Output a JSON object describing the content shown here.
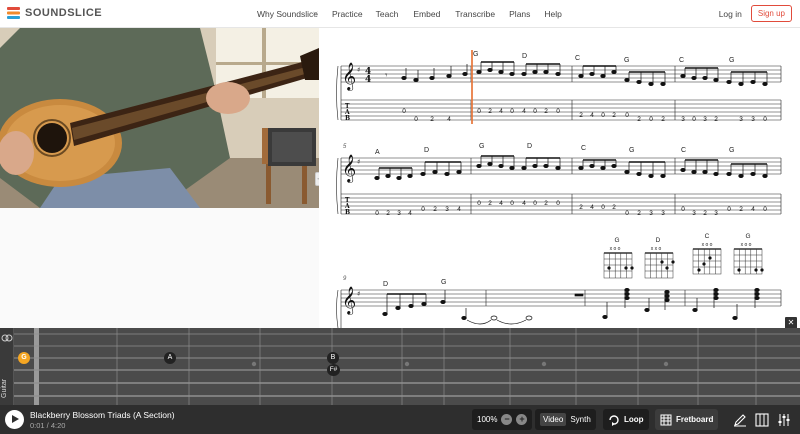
{
  "nav": {
    "brand": "SOUNDSLICE",
    "links": [
      "Why Soundslice",
      "Practice",
      "Teach",
      "Embed",
      "Transcribe",
      "Plans",
      "Help"
    ],
    "login": "Log in",
    "signup": "Sign up"
  },
  "score": {
    "time_sig_top": "4",
    "time_sig_bottom": "4",
    "measure_numbers": [
      "5",
      "9"
    ],
    "row1_chords": [
      "G",
      "D",
      "C",
      "G",
      "C",
      "G"
    ],
    "row1_tab": [
      "0",
      "0",
      "2",
      "4",
      "0",
      "2",
      "4",
      "0",
      "4",
      "0",
      "2",
      "0",
      "2",
      "4",
      "0",
      "2",
      "0",
      "2",
      "0",
      "2",
      "3",
      "0",
      "3",
      "2",
      "3",
      "3",
      "0"
    ],
    "row2_chords": [
      "A",
      "D",
      "G",
      "D",
      "C",
      "G",
      "C",
      "G"
    ],
    "row2_tab": [
      "0",
      "2",
      "3",
      "4",
      "0",
      "2",
      "3",
      "4",
      "0",
      "2",
      "4",
      "0",
      "4",
      "0",
      "2",
      "0",
      "2",
      "4",
      "0",
      "2",
      "0",
      "2",
      "3",
      "3",
      "0",
      "3",
      "2",
      "3",
      "0",
      "2",
      "4",
      "0"
    ],
    "row3_chords": [
      "D",
      "G"
    ],
    "diagram_chords": [
      "G",
      "D",
      "C",
      "G"
    ],
    "diagram_marks": [
      "x o o",
      "x x o",
      "x o o",
      "x o o"
    ]
  },
  "fretboard": {
    "instrument": "Guitar",
    "open_note": "G",
    "notes": [
      "A",
      "B",
      "F#"
    ]
  },
  "player": {
    "title": "Blackberry Blossom Triads (A Section)",
    "time": "0:01 / 4:20",
    "zoom": "100%",
    "video_label": "Video",
    "synth_label": "Synth",
    "loop_label": "Loop",
    "fretboard_label": "Fretboard"
  },
  "colors": {
    "accent": "#e14b3b",
    "playhead": "#e8763a",
    "note_dot": "#f5a623"
  }
}
